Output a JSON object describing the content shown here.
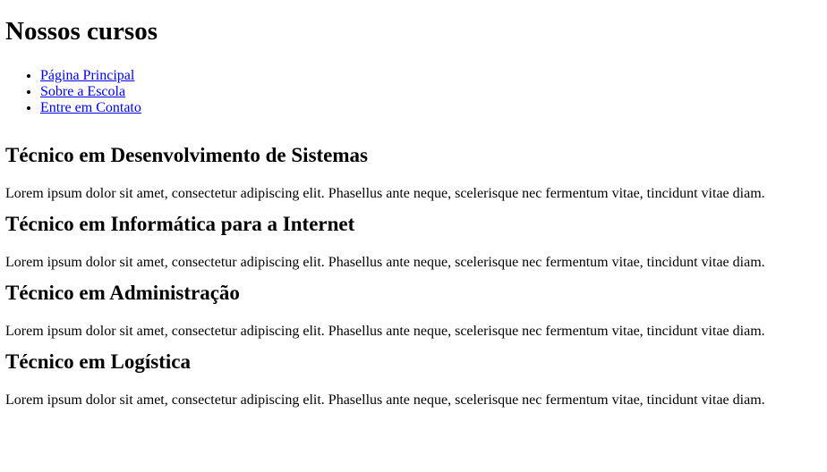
{
  "page": {
    "title": "Nossos cursos"
  },
  "nav": {
    "items": [
      {
        "label": "Página Principal"
      },
      {
        "label": "Sobre a Escola"
      },
      {
        "label": "Entre em Contato"
      }
    ]
  },
  "courses": [
    {
      "title": "Técnico em Desenvolvimento de Sistemas",
      "description": "Lorem ipsum dolor sit amet, consectetur adipiscing elit. Phasellus ante neque, scelerisque nec fermentum vitae, tincidunt vitae diam."
    },
    {
      "title": "Técnico em Informática para a Internet",
      "description": "Lorem ipsum dolor sit amet, consectetur adipiscing elit. Phasellus ante neque, scelerisque nec fermentum vitae, tincidunt vitae diam."
    },
    {
      "title": "Técnico em Administração",
      "description": "Lorem ipsum dolor sit amet, consectetur adipiscing elit. Phasellus ante neque, scelerisque nec fermentum vitae, tincidunt vitae diam."
    },
    {
      "title": "Técnico em Logística",
      "description": "Lorem ipsum dolor sit amet, consectetur adipiscing elit. Phasellus ante neque, scelerisque nec fermentum vitae, tincidunt vitae diam."
    }
  ]
}
